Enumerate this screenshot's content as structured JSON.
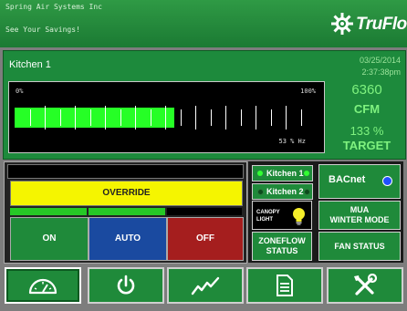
{
  "header": {
    "company": "Spring Air Systems Inc",
    "tagline": "See Your Savings!",
    "logo_text": "TruFlow",
    "logo_icon": "gear-icon"
  },
  "status_panel": {
    "zone_name": "Kitchen 1",
    "date": "03/25/2014",
    "time": "2:37:38pm",
    "gauge": {
      "min_label": "0%",
      "max_label": "100%",
      "fill_fraction": 0.53,
      "hz_label": "53 % Hz"
    },
    "cfm_value": "6360",
    "cfm_label": "CFM",
    "percent_value": "133 %",
    "percent_label": "TARGET"
  },
  "mode_control": {
    "override_label": "OVERRIDE",
    "on_label": "ON",
    "auto_label": "AUTO",
    "off_label": "OFF",
    "colors": {
      "on": "#1f8a3a",
      "auto": "#1a4aa0",
      "off": "#a51e1e",
      "override": "#f5f500",
      "active_indicator": "#26c826"
    }
  },
  "side_panel": {
    "kitchen1_label": "Kitchen 1",
    "kitchen2_label": "Kitchen 2",
    "bacnet_label": "BACnet",
    "canopy_light_label_line1": "CANOPY",
    "canopy_light_label_line2": "LIGHT",
    "mua_line1": "MUA",
    "mua_line2": "WINTER MODE",
    "zoneflow_line1": "ZONEFLOW",
    "zoneflow_line2": "STATUS",
    "fan_status_label": "FAN STATUS"
  },
  "nav": {
    "icons": [
      "speedometer-icon",
      "power-icon",
      "trend-chart-icon",
      "document-icon",
      "tools-icon"
    ]
  }
}
